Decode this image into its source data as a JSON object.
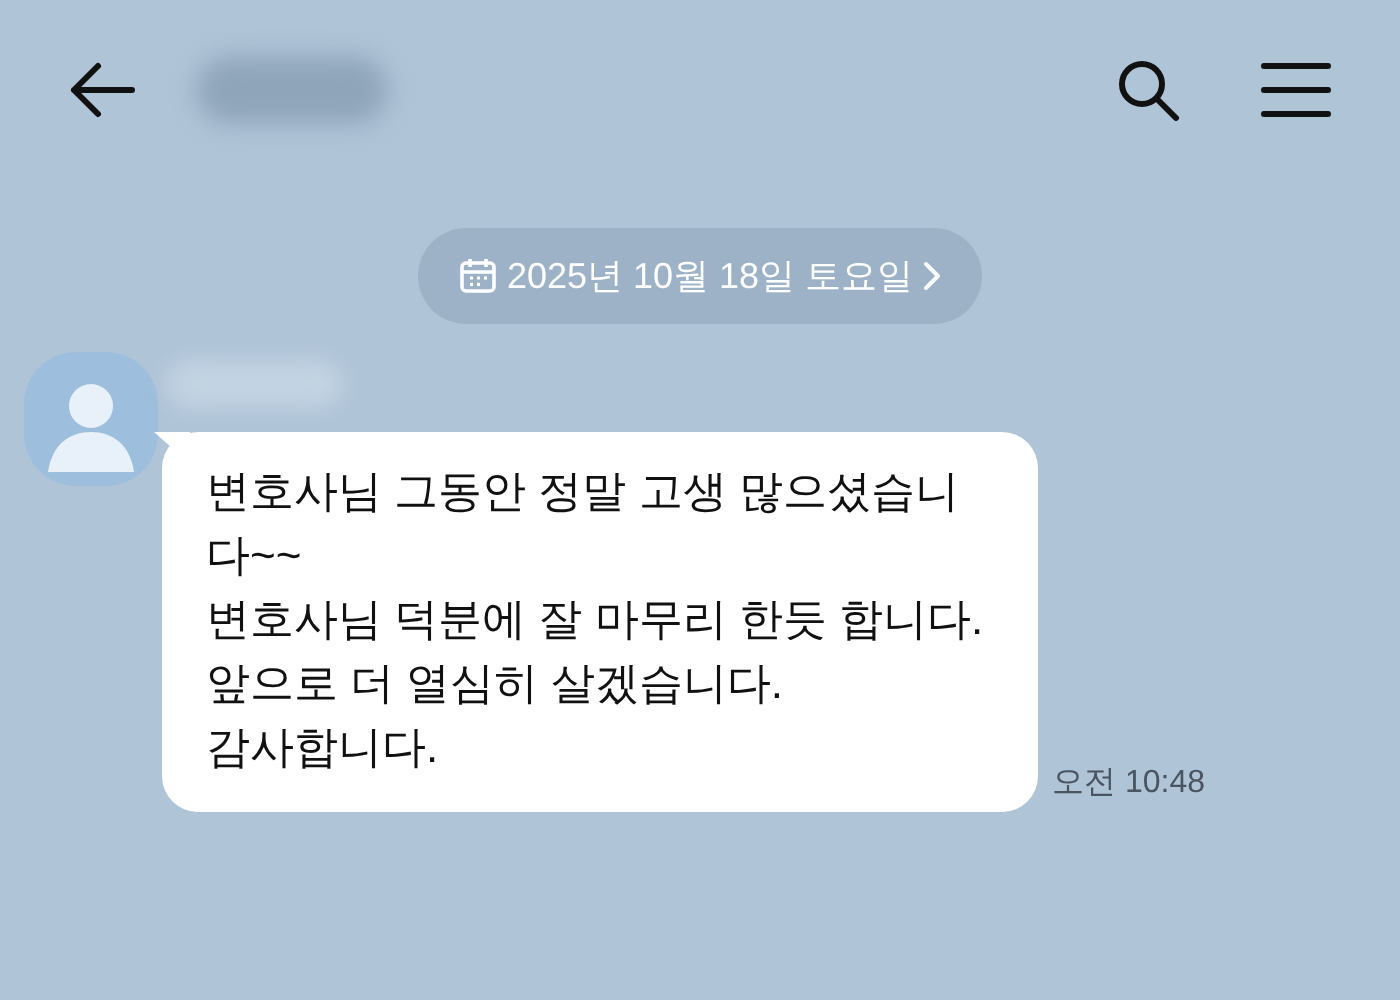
{
  "date_pill": {
    "label": "2025년 10월 18일 토요일"
  },
  "messages": [
    {
      "text": "변호사님 그동안 정말 고생 많으셨습니다~~\n변호사님 덕분에 잘 마무리 한듯 합니다.\n앞으로 더 열심히 살겠습니다.\n감사합니다.",
      "time": "오전 10:48"
    }
  ]
}
